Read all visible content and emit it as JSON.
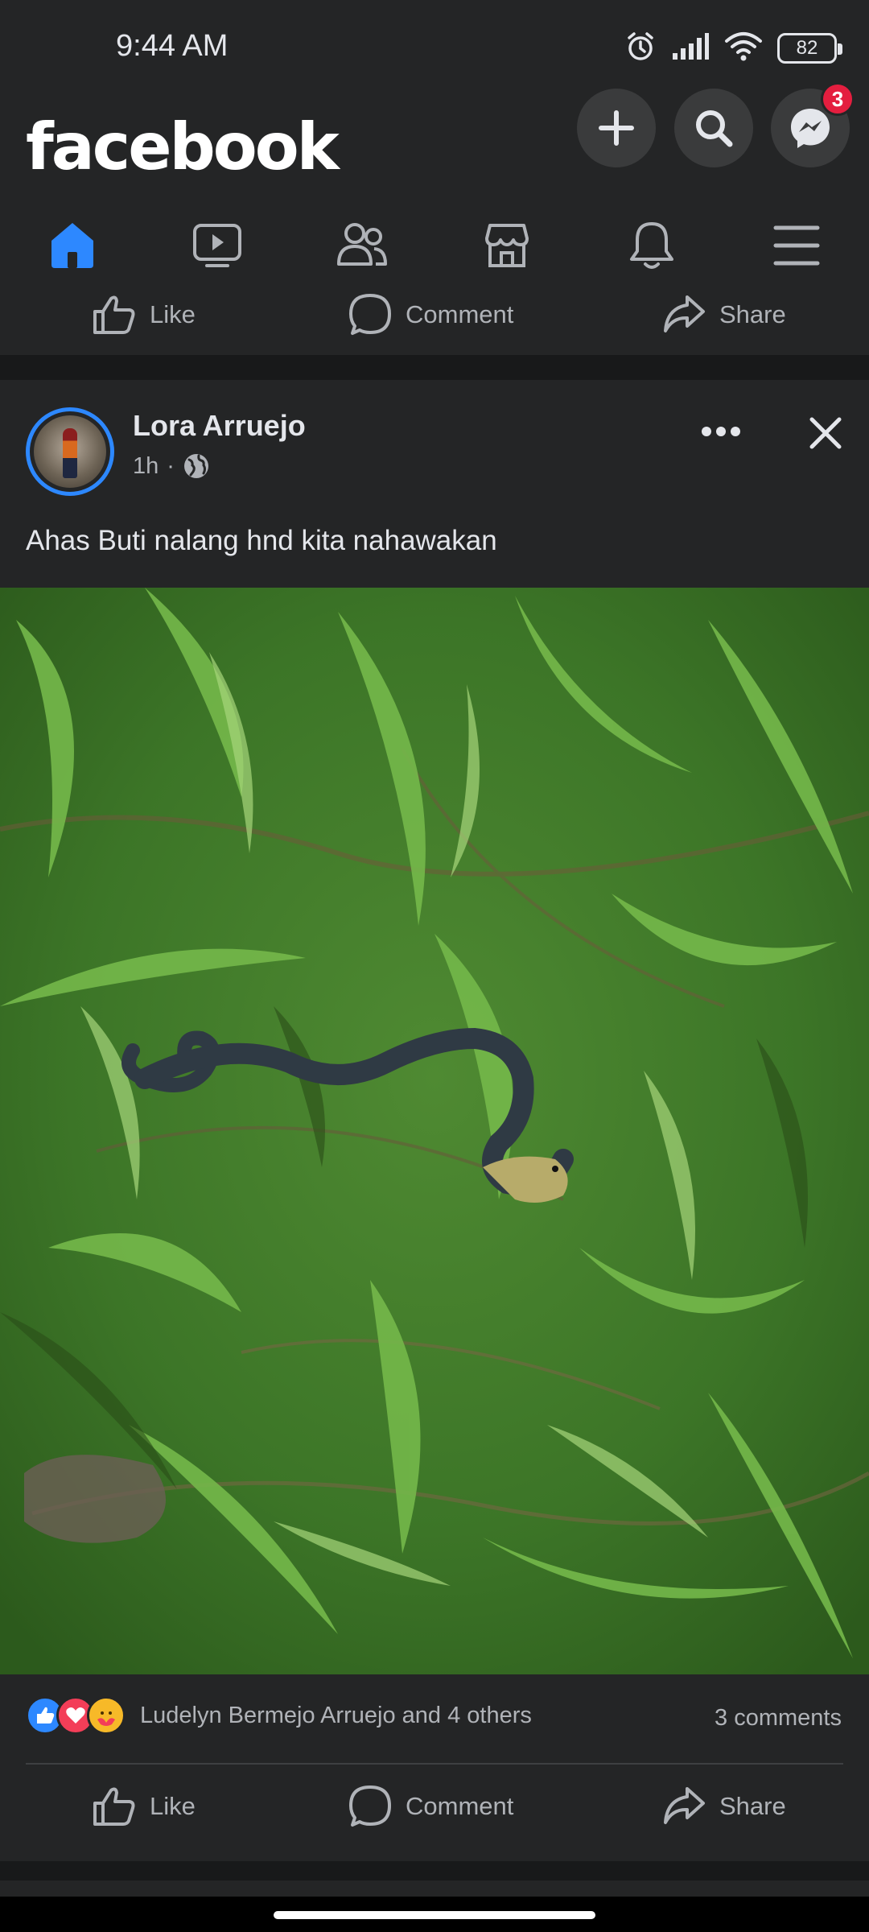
{
  "status_bar": {
    "time": "9:44 AM",
    "battery": "82",
    "icons": [
      "alarm-icon",
      "signal-icon",
      "wifi-icon",
      "battery-icon"
    ]
  },
  "header": {
    "logo": "facebook",
    "buttons": [
      "create-icon",
      "search-icon",
      "messenger-icon"
    ],
    "messenger_badge": "3"
  },
  "tabs": [
    {
      "name": "home",
      "icon": "home-icon",
      "active": true
    },
    {
      "name": "watch",
      "icon": "video-icon"
    },
    {
      "name": "friends",
      "icon": "friends-icon"
    },
    {
      "name": "marketplace",
      "icon": "marketplace-icon"
    },
    {
      "name": "notifications",
      "icon": "bell-icon"
    },
    {
      "name": "menu",
      "icon": "hamburger-icon"
    }
  ],
  "previous_post_actions": {
    "like": "Like",
    "comment": "Comment",
    "share": "Share"
  },
  "post": {
    "author": "Lora Arruejo",
    "time": "1h",
    "separator": "·",
    "audience_icon": "globe-icon",
    "caption": "Ahas Buti nalang hnd kita nahawakan",
    "reactions": [
      "like",
      "love",
      "care"
    ],
    "reactions_text": "Ludelyn Bermejo Arruejo and 4 others",
    "comments": "3 comments",
    "actions": {
      "like": "Like",
      "comment": "Comment",
      "share": "Share"
    }
  },
  "colors": {
    "background": "#18191a",
    "surface": "#242526",
    "accent": "#2d88ff",
    "text": "#e4e6eb",
    "secondary_text": "#b0b3b8",
    "badge": "#e41e3f"
  }
}
